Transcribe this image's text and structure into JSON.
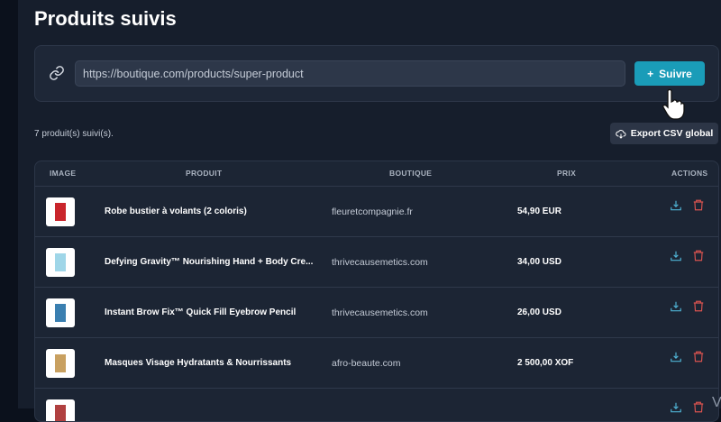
{
  "header": {
    "title": "Produits suivis"
  },
  "track": {
    "url_value": "https://boutique.com/products/super-product",
    "follow_label": "Suivre",
    "link_icon": "link-icon",
    "plus_icon": "plus-icon"
  },
  "summary": {
    "count_text": "7 produit(s) suivi(s).",
    "export_label": "Export CSV global",
    "export_icon": "cloud-download-icon"
  },
  "table": {
    "columns": [
      "IMAGE",
      "PRODUIT",
      "BOUTIQUE",
      "PRIX",
      "ACTIONS"
    ],
    "rows": [
      {
        "product": "Robe bustier à volants (2 coloris)",
        "shop": "fleuretcompagnie.fr",
        "price": "54,90 EUR",
        "thumb_color": "#c9252b"
      },
      {
        "product": "Defying Gravity™ Nourishing Hand + Body Cre...",
        "shop": "thrivecausemetics.com",
        "price": "34,00 USD",
        "thumb_color": "#9fd6e8"
      },
      {
        "product": "Instant Brow Fix™ Quick Fill Eyebrow Pencil",
        "shop": "thrivecausemetics.com",
        "price": "26,00 USD",
        "thumb_color": "#3a7fb0"
      },
      {
        "product": "Masques Visage Hydratants & Nourrissants",
        "shop": "afro-beaute.com",
        "price": "2 500,00 XOF",
        "thumb_color": "#c8a060"
      },
      {
        "product": "",
        "shop": "",
        "price": "",
        "thumb_color": "#b04040"
      }
    ],
    "action_icons": [
      "download-icon",
      "trash-icon"
    ]
  },
  "colors": {
    "accent": "#1a9cb8",
    "danger": "#d9534f",
    "download": "#4fb3d4"
  },
  "partial_text": "V"
}
